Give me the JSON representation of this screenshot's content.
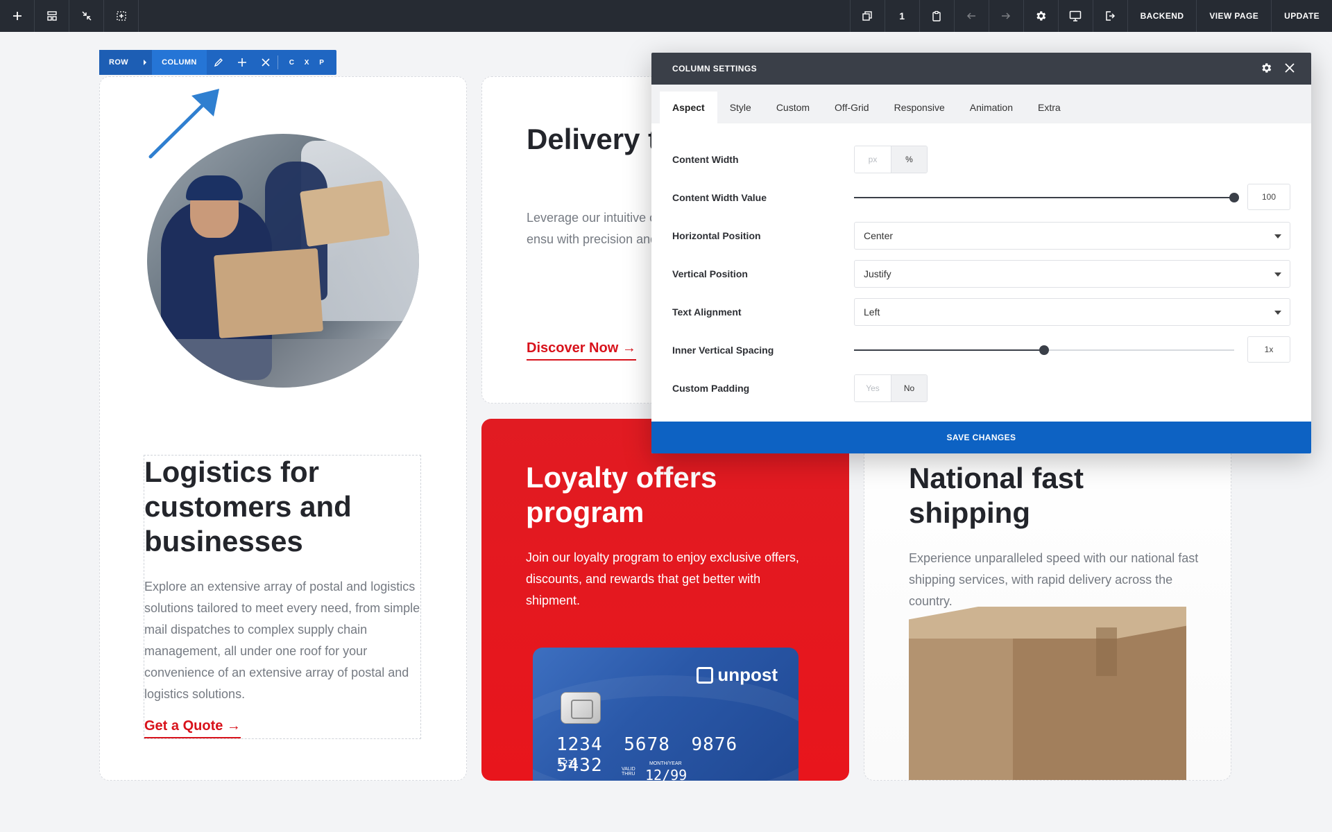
{
  "toolbar": {
    "page_number": "1",
    "backend_label": "BACKEND",
    "view_page_label": "VIEW PAGE",
    "update_label": "UPDATE"
  },
  "rowbar": {
    "row_label": "ROW",
    "column_label": "COLUMN",
    "cxp_label": "C X P"
  },
  "cards": {
    "logistics": {
      "heading": "Logistics for customers and businesses",
      "text": "Explore an extensive array of postal and logistics solutions tailored to meet every need, from simple mail dispatches to complex supply chain management, all under one roof for your convenience of an extensive array of postal and logistics solutions.",
      "link": "Get a Quote →"
    },
    "delivery": {
      "heading": "Delivery t calculato",
      "text": "Leverage our intuitive calculator to get accu your shipments, ensu with precision and co",
      "link": "Discover Now →"
    },
    "loyalty": {
      "heading": "Loyalty offers program",
      "text": "Join our loyalty program to enjoy exclusive offers, discounts, and rewards that get better with shipment.",
      "card_brand": "unpost",
      "card_number": "1234 5678 9876 5432",
      "card_small_number": "1234",
      "card_valid": "VALID THRU",
      "card_month_year": "MONTH/YEAR",
      "card_expiry": "12/99"
    },
    "national": {
      "heading": "National fast shipping",
      "text": "Experience unparalleled speed with our national fast shipping services, with rapid delivery across the country."
    }
  },
  "panel": {
    "title": "COLUMN SETTINGS",
    "tabs": [
      "Aspect",
      "Style",
      "Custom",
      "Off-Grid",
      "Responsive",
      "Animation",
      "Extra"
    ],
    "active_tab": "Aspect",
    "fields": {
      "content_width": {
        "label": "Content Width",
        "options": [
          "px",
          "%"
        ],
        "selected": "%"
      },
      "content_width_value": {
        "label": "Content Width Value",
        "value": "100",
        "slider_fraction": 1.0
      },
      "horizontal_position": {
        "label": "Horizontal Position",
        "value": "Center"
      },
      "vertical_position": {
        "label": "Vertical Position",
        "value": "Justify"
      },
      "text_alignment": {
        "label": "Text Alignment",
        "value": "Left"
      },
      "inner_vertical_spacing": {
        "label": "Inner Vertical Spacing",
        "value": "1x",
        "slider_fraction": 0.5
      },
      "custom_padding": {
        "label": "Custom Padding",
        "options": [
          "Yes",
          "No"
        ],
        "selected": "No"
      }
    },
    "save_label": "SAVE CHANGES"
  },
  "colors": {
    "toolbar_bg": "#262b33",
    "accent_blue": "#0d62c3",
    "brand_red": "#e11b22",
    "link_red": "#d8121b"
  }
}
